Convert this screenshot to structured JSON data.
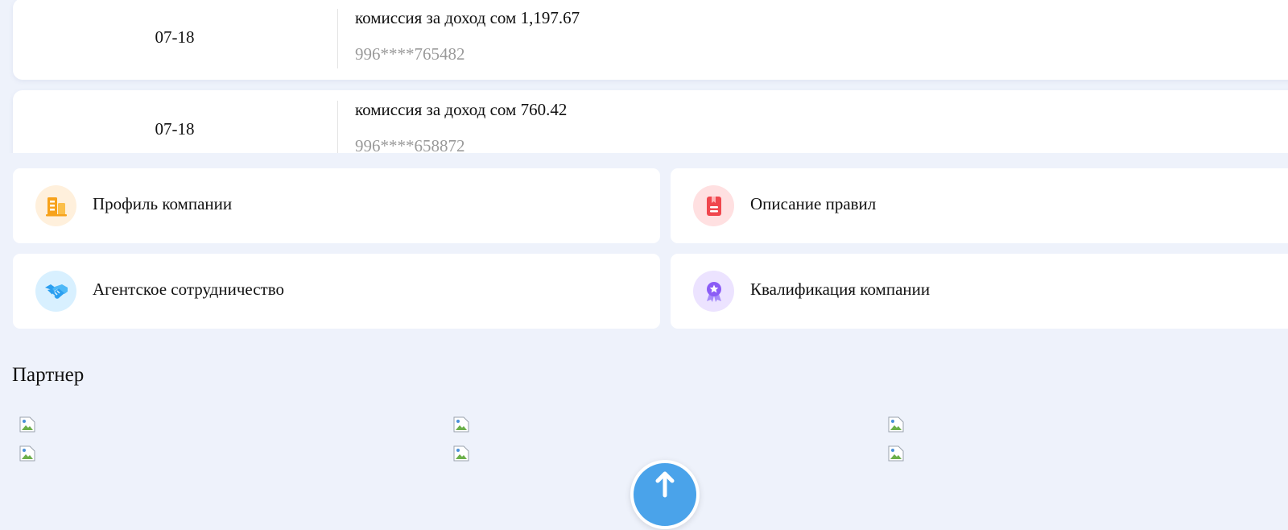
{
  "transactions": [
    {
      "date": "07-18",
      "title": "комиссия за доход сом 1,197.67",
      "phone": "996****765482"
    },
    {
      "date": "07-18",
      "title": "комиссия за доход сом 760.42",
      "phone": "996****658872"
    }
  ],
  "menu": [
    {
      "label": "Профиль компании",
      "icon": "building-icon",
      "color": "#f7a21b"
    },
    {
      "label": "Описание правил",
      "icon": "rulebook-icon",
      "color": "#f0474e"
    },
    {
      "label": "Агентское сотрудничество",
      "icon": "handshake-icon",
      "color": "#2b9ff0"
    },
    {
      "label": "Квалификация компании",
      "icon": "award-icon",
      "color": "#8b5cf6"
    }
  ],
  "partners": {
    "title": "Партнер"
  },
  "colors": {
    "background": "#eef2fb",
    "card": "#ffffff",
    "muted_text": "#9a9a9a",
    "fab": "#4aa3ea"
  }
}
